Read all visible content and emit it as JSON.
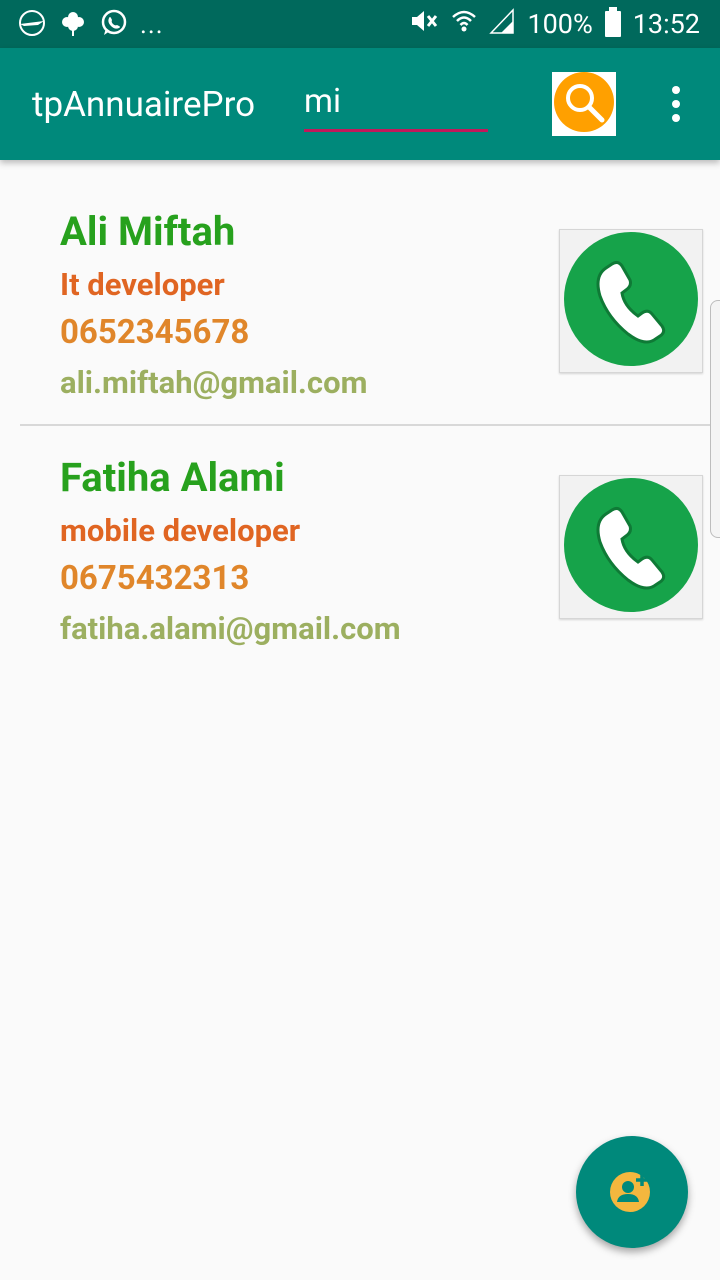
{
  "status_bar": {
    "left_icons": [
      "app-notification-icon",
      "flower-notification-icon",
      "whatsapp-icon"
    ],
    "overflow": "...",
    "right_icons": [
      "mute-icon",
      "wifi-icon",
      "signal-icon",
      "battery-icon"
    ],
    "battery": "100%",
    "time": "13:52"
  },
  "app_bar": {
    "title": "tpAnnuairePro",
    "search_value": "mi",
    "search_icon": "search-icon",
    "overflow_icon": "more-vert-icon"
  },
  "contacts": [
    {
      "name": "Ali Miftah",
      "job": "It developer",
      "phone": "0652345678",
      "email": "ali.miftah@gmail.com",
      "call_icon": "phone-call-icon"
    },
    {
      "name": "Fatiha Alami",
      "job": "mobile developer",
      "phone": "0675432313",
      "email": "fatiha.alami@gmail.com",
      "call_icon": "phone-call-icon"
    }
  ],
  "fab": {
    "icon": "add-person-icon"
  },
  "colors": {
    "status_bar": "#00695c",
    "app_bar": "#00897b",
    "name": "#27a11d",
    "job": "#e06522",
    "phone": "#e0862a",
    "email": "#9caf60",
    "search_button": "#ffa000",
    "call_button": "#16a34a",
    "underline": "#c2185b"
  }
}
